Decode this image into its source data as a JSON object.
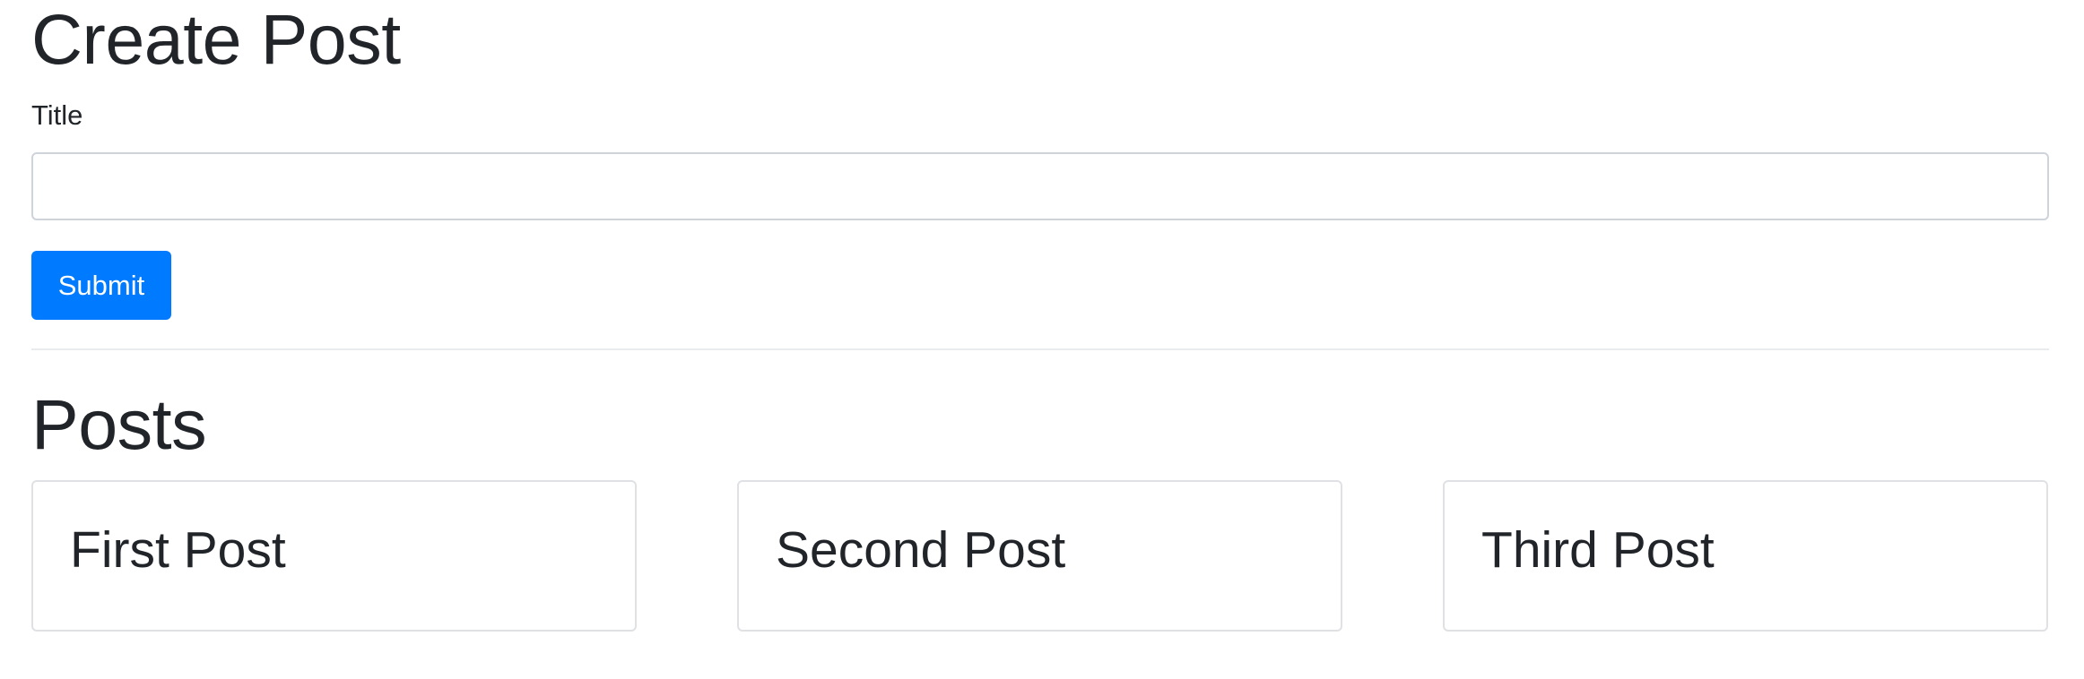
{
  "create": {
    "heading": "Create Post",
    "title_label": "Title",
    "title_value": "",
    "submit_label": "Submit"
  },
  "posts": {
    "heading": "Posts",
    "items": [
      {
        "title": "First Post"
      },
      {
        "title": "Second Post"
      },
      {
        "title": "Third Post"
      }
    ]
  },
  "colors": {
    "primary": "#007bff",
    "text": "#212529",
    "border": "#ced4da"
  }
}
